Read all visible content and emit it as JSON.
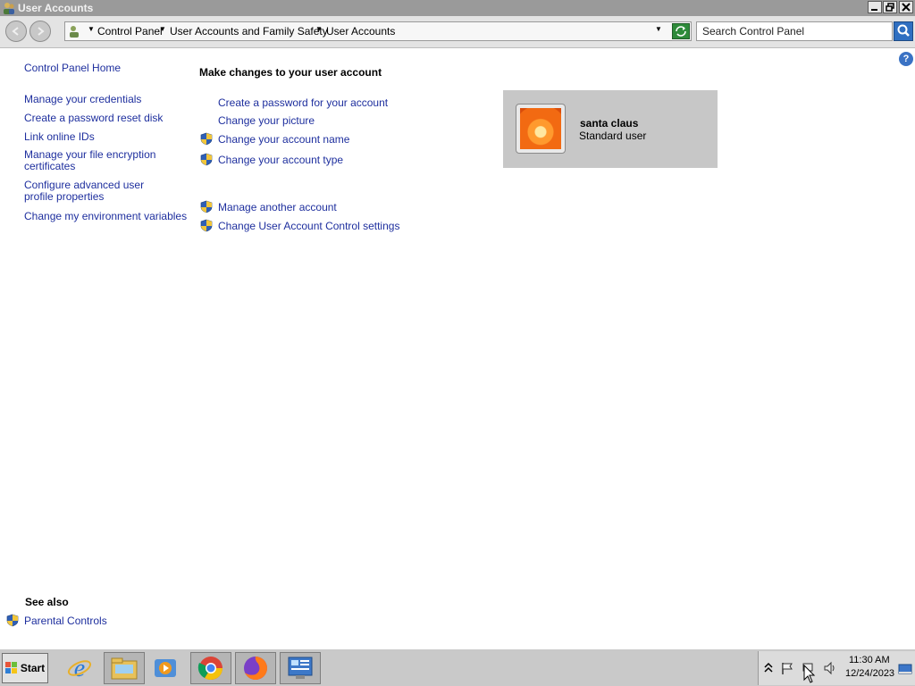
{
  "window": {
    "title": "User Accounts"
  },
  "address_bar": {
    "breadcrumbs": [
      "Control Panel",
      "User Accounts and Family Safety",
      "User Accounts"
    ],
    "search_placeholder": "Search Control Panel"
  },
  "left_pane": {
    "home": "Control Panel Home",
    "links": [
      "Manage your credentials",
      "Create a password reset disk",
      "Link online IDs",
      "Manage your file encryption certificates",
      "Configure advanced user profile properties",
      "Change my environment variables"
    ],
    "see_also_heading": "See also",
    "see_also_links": [
      "Parental Controls"
    ]
  },
  "main": {
    "heading": "Make changes to your user account",
    "tasks": [
      "Create a password for your account",
      "Change your picture",
      "Change your account name",
      "Change your account type"
    ],
    "other_tasks": [
      "Manage another account",
      "Change User Account Control settings"
    ]
  },
  "account": {
    "name": "santa claus",
    "type": "Standard user"
  },
  "taskbar": {
    "start_label": "Start",
    "apps": [
      "internet-explorer",
      "windows-explorer",
      "media-player",
      "chrome",
      "firefox",
      "control-panel"
    ],
    "clock": {
      "time": "11:30 AM",
      "date": "12/24/2023"
    }
  },
  "colors": {
    "link": "#1e2f9e",
    "titlebar": "#9a9a9a",
    "tile": "#c7c7c7"
  }
}
